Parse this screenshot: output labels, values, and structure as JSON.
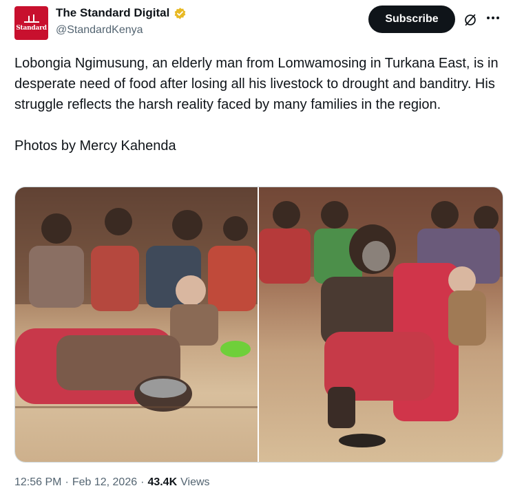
{
  "account": {
    "display_name": "The Standard Digital",
    "handle": "@StandardKenya",
    "avatar_text": "Standard",
    "verified_color": "#e8b923"
  },
  "actions": {
    "subscribe_label": "Subscribe"
  },
  "tweet": {
    "paragraph_1": "Lobongia Ngimusung, an elderly man from Lomwamosing in Turkana East, is in desperate need of food after losing all his livestock to drought and banditry. His struggle reflects the harsh reality faced by many families in the region.",
    "paragraph_2": "Photos by Mercy Kahenda"
  },
  "media": {
    "photo_count": 2
  },
  "meta": {
    "time": "12:56 PM",
    "separator": "·",
    "date": "Feb 12, 2026",
    "views_count": "43.4K",
    "views_label": "Views"
  },
  "colors": {
    "subscribe_bg": "#0f1419",
    "secondary_text": "#536471",
    "brand_red": "#c8102e"
  }
}
